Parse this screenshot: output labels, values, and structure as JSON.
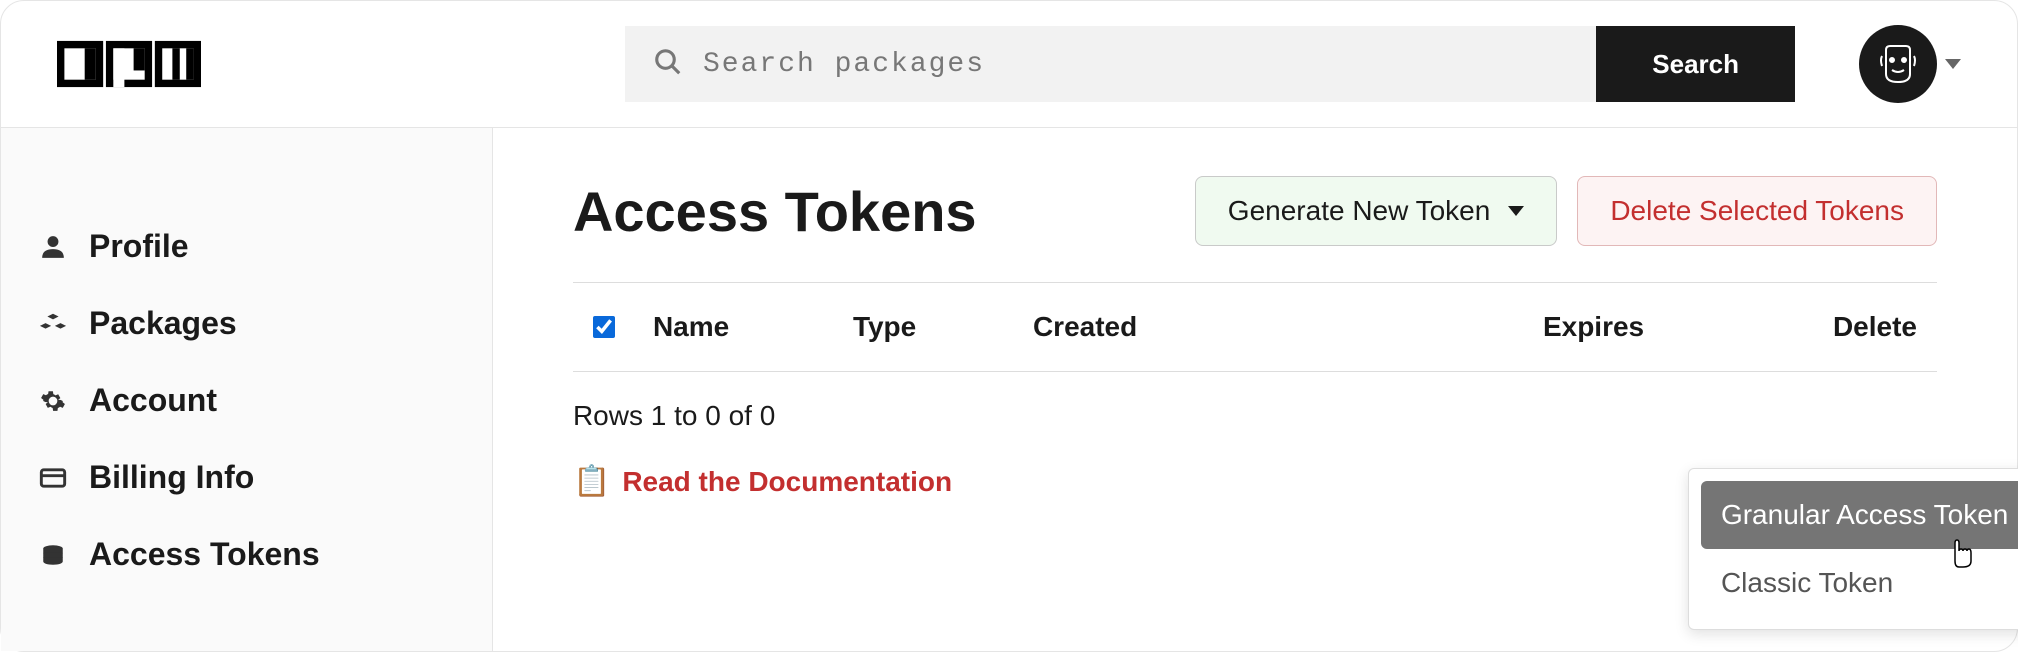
{
  "header": {
    "search_placeholder": "Search packages",
    "search_button": "Search"
  },
  "sidebar": {
    "items": [
      {
        "label": "Profile",
        "icon": "user"
      },
      {
        "label": "Packages",
        "icon": "cubes"
      },
      {
        "label": "Account",
        "icon": "gear"
      },
      {
        "label": "Billing Info",
        "icon": "credit-card"
      },
      {
        "label": "Access Tokens",
        "icon": "coins"
      }
    ]
  },
  "main": {
    "title": "Access Tokens",
    "generate_button": "Generate New Token",
    "delete_button": "Delete Selected Tokens",
    "columns": {
      "name": "Name",
      "type": "Type",
      "created": "Created",
      "expires": "Expires",
      "delete": "Delete"
    },
    "rows_text": "Rows 1 to 0 of 0",
    "doc_link": "Read the Documentation"
  },
  "dropdown": {
    "options": [
      "Granular Access Token",
      "Classic Token"
    ]
  }
}
